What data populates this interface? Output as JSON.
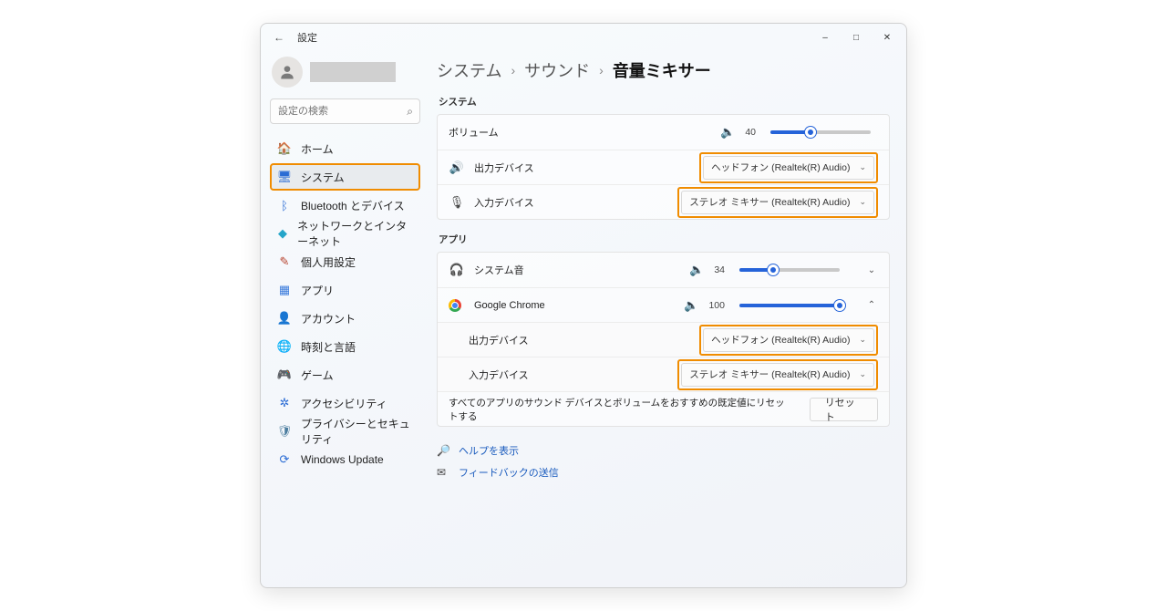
{
  "window": {
    "title": "設定",
    "minimize": "–",
    "maximize": "□",
    "close": "✕"
  },
  "sidebar": {
    "search_placeholder": "設定の検索",
    "items": [
      {
        "label": "ホーム",
        "icon": "🏠",
        "color": "#d38d3f"
      },
      {
        "label": "システム",
        "icon": "🖥",
        "color": "#2b6cd4",
        "selected": true
      },
      {
        "label": "Bluetooth とデバイス",
        "icon": "ᛒ",
        "color": "#2b6cd4"
      },
      {
        "label": "ネットワークとインターネット",
        "icon": "◆",
        "color": "#25a5c9"
      },
      {
        "label": "個人用設定",
        "icon": "✎",
        "color": "#b8432f"
      },
      {
        "label": "アプリ",
        "icon": "▦",
        "color": "#3a7bdc"
      },
      {
        "label": "アカウント",
        "icon": "👤",
        "color": "#4a9a3a"
      },
      {
        "label": "時刻と言語",
        "icon": "🌐",
        "color": "#3a7bdc"
      },
      {
        "label": "ゲーム",
        "icon": "🎮",
        "color": "#777"
      },
      {
        "label": "アクセシビリティ",
        "icon": "✲",
        "color": "#2b6cd4"
      },
      {
        "label": "プライバシーとセキュリティ",
        "icon": "🛡",
        "color": "#4a7c9e"
      },
      {
        "label": "Windows Update",
        "icon": "⟳",
        "color": "#2b6cd4"
      }
    ]
  },
  "breadcrumb": {
    "p1": "システム",
    "p2": "サウンド",
    "current": "音量ミキサー"
  },
  "system_section": {
    "label": "システム",
    "volume_label": "ボリューム",
    "volume_value": "40",
    "volume_pct": 40,
    "output_label": "出力デバイス",
    "output_value": "ヘッドフォン (Realtek(R) Audio)",
    "input_label": "入力デバイス",
    "input_value": "ステレオ ミキサー (Realtek(R) Audio)"
  },
  "apps_section": {
    "label": "アプリ",
    "sys_sound_label": "システム音",
    "sys_sound_value": "34",
    "sys_sound_pct": 34,
    "chrome_label": "Google Chrome",
    "chrome_value": "100",
    "chrome_pct": 100,
    "chrome_output_label": "出力デバイス",
    "chrome_output_value": "ヘッドフォン (Realtek(R) Audio)",
    "chrome_input_label": "入力デバイス",
    "chrome_input_value": "ステレオ ミキサー (Realtek(R) Audio)"
  },
  "reset": {
    "text": "すべてのアプリのサウンド デバイスとボリュームをおすすめの既定値にリセットする",
    "button": "リセット"
  },
  "footer": {
    "help": "ヘルプを表示",
    "feedback": "フィードバックの送信"
  }
}
